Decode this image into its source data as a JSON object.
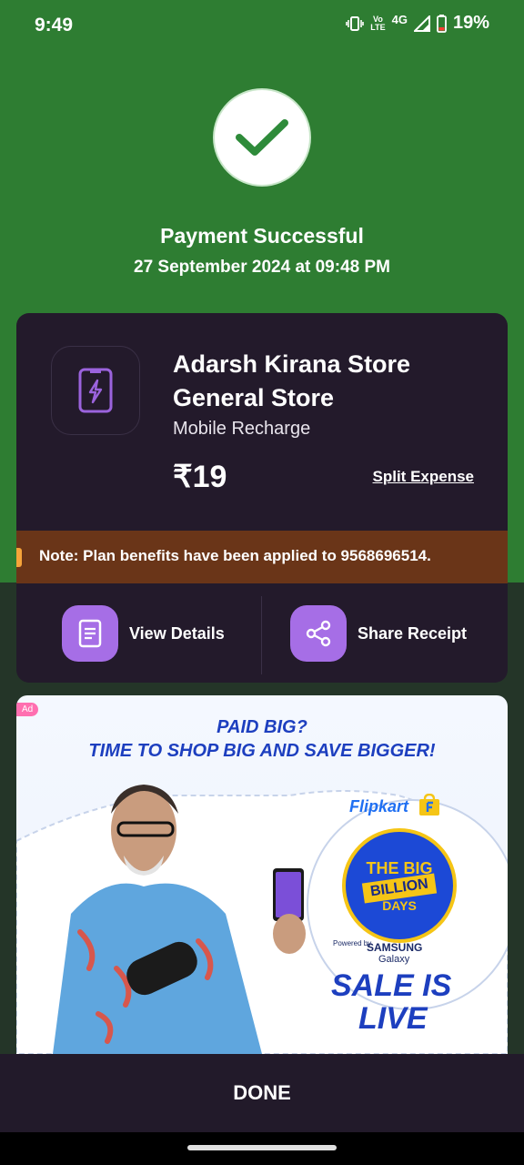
{
  "status_bar": {
    "time": "9:49",
    "volte_top": "Vo",
    "volte_bottom": "LTE",
    "network": "4G",
    "battery_percent": "19%"
  },
  "payment": {
    "title": "Payment Successful",
    "date": "27 September 2024 at 09:48 PM"
  },
  "merchant": {
    "name_line1": "Adarsh Kirana Store",
    "name_line2": "General Store",
    "category": "Mobile Recharge",
    "amount": "₹19",
    "split_expense_label": "Split Expense"
  },
  "note": {
    "text": "Note: Plan benefits have been applied to 9568696514."
  },
  "actions": {
    "view_details": "View Details",
    "share_receipt": "Share Receipt"
  },
  "ad": {
    "badge": "Ad",
    "headline1": "PAID BIG?",
    "headline2": "TIME TO SHOP BIG AND SAVE BIGGER!",
    "brand": "Flipkart",
    "bbd_the": "THE BIG",
    "bbd_billion": "BILLION",
    "bbd_days": "DAYS",
    "powered_by": "Powered by",
    "sponsor": "SAMSUNG",
    "sponsor_sub": "Galaxy",
    "sale_line1": "SALE IS",
    "sale_line2": "LIVE"
  },
  "footer": {
    "done_label": "DONE"
  },
  "colors": {
    "success_green": "#2e7d32",
    "card_bg": "#231a2b",
    "accent_purple": "#a66ee6",
    "note_bg": "#6a3518"
  }
}
